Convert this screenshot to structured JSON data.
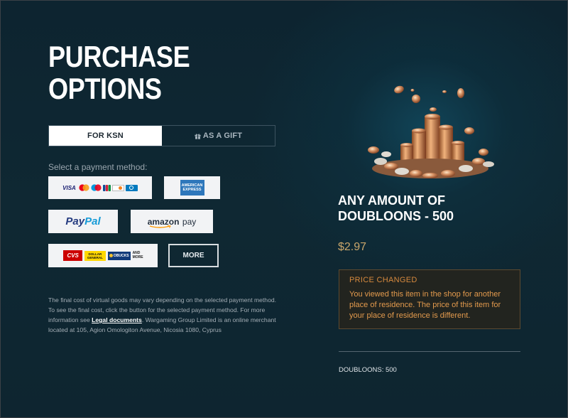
{
  "page": {
    "title": "PURCHASE\nOPTIONS"
  },
  "tabs": [
    {
      "label": "FOR KSN",
      "active": true
    },
    {
      "label": "AS A GIFT",
      "active": false,
      "icon": "gift-icon"
    }
  ],
  "payment": {
    "label": "Select a payment method:",
    "methods": [
      {
        "name": "cards",
        "logos": [
          "VISA",
          "Mastercard",
          "Maestro",
          "JCB",
          "DISCOVER",
          "Diners Club"
        ]
      },
      {
        "name": "american-express",
        "text": "AMERICAN EXPRESS"
      },
      {
        "name": "paypal",
        "text_pay": "Pay",
        "text_pal": "Pal"
      },
      {
        "name": "amazon-pay",
        "text_amazon": "amazon",
        "text_pay": "pay"
      },
      {
        "name": "retail",
        "cvs": "CVS",
        "dollar_general": "DOLLAR GENERAL",
        "obucks": "OBUCKS",
        "and_more": "AND MORE"
      }
    ],
    "more_label": "MORE"
  },
  "disclaimer": {
    "text_before": "The final cost of virtual goods may vary depending on the selected payment method. To see the final cost, click the button for the selected payment method. For more information see ",
    "link": "Legal documents",
    "text_after": ". Wargaming Group Limited is an online merchant located at 105, Agion Omologiton Avenue, Nicosia 1080, Cyprus"
  },
  "product": {
    "image_icon": "doubloon-coins-image",
    "title": "ANY AMOUNT OF DOUBLOONS - 500",
    "price": "$2.97"
  },
  "notice": {
    "title": "PRICE CHANGED",
    "text": "You viewed this item in the shop for another place of residence. The price of this item for your place of residence is different."
  },
  "summary": {
    "line": "DOUBLOONS: 500"
  },
  "colors": {
    "background": "#0f2833",
    "price": "#c9a66b",
    "notice_accent": "#d6893e",
    "paypal_dark": "#253b80",
    "paypal_light": "#179bd7",
    "amex_blue": "#2e77bb"
  }
}
